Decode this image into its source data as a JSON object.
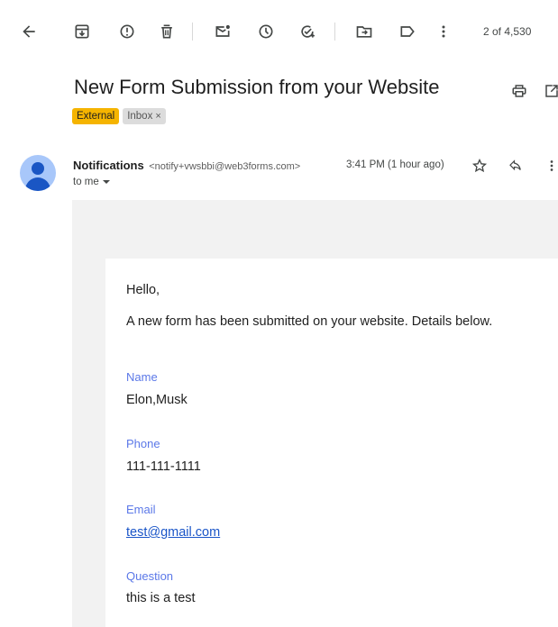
{
  "toolbar": {
    "icons": [
      "back-arrow-icon",
      "archive-icon",
      "report-spam-icon",
      "delete-icon",
      "mark-unread-icon",
      "snooze-icon",
      "add-task-icon",
      "move-to-icon",
      "label-icon",
      "more-icon"
    ],
    "page_count": "2 of 4,530"
  },
  "message": {
    "subject": "New Form Submission from your Website",
    "labels": {
      "external": "External",
      "inbox": "Inbox",
      "inbox_remove": "×"
    },
    "sender_name": "Notifications",
    "sender_email": "<notify+vwsbbi@web3forms.com>",
    "time": "3:41 PM (1 hour ago)",
    "recipient": "to me"
  },
  "body": {
    "greeting": "Hello,",
    "intro": "A new form has been submitted on your website. Details below.",
    "fields": [
      {
        "label": "Name",
        "value": "Elon,Musk"
      },
      {
        "label": "Phone",
        "value": "111-111-1111"
      },
      {
        "label": "Email",
        "value": "test@gmail.com"
      },
      {
        "label": "Question",
        "value": "this is a test"
      }
    ]
  },
  "colors": {
    "external_label": "#f5b400",
    "field_label": "#5b78e8",
    "link": "#1a55c8",
    "avatar_bg": "#a8c7fa",
    "avatar_fg": "#1a56c4"
  }
}
